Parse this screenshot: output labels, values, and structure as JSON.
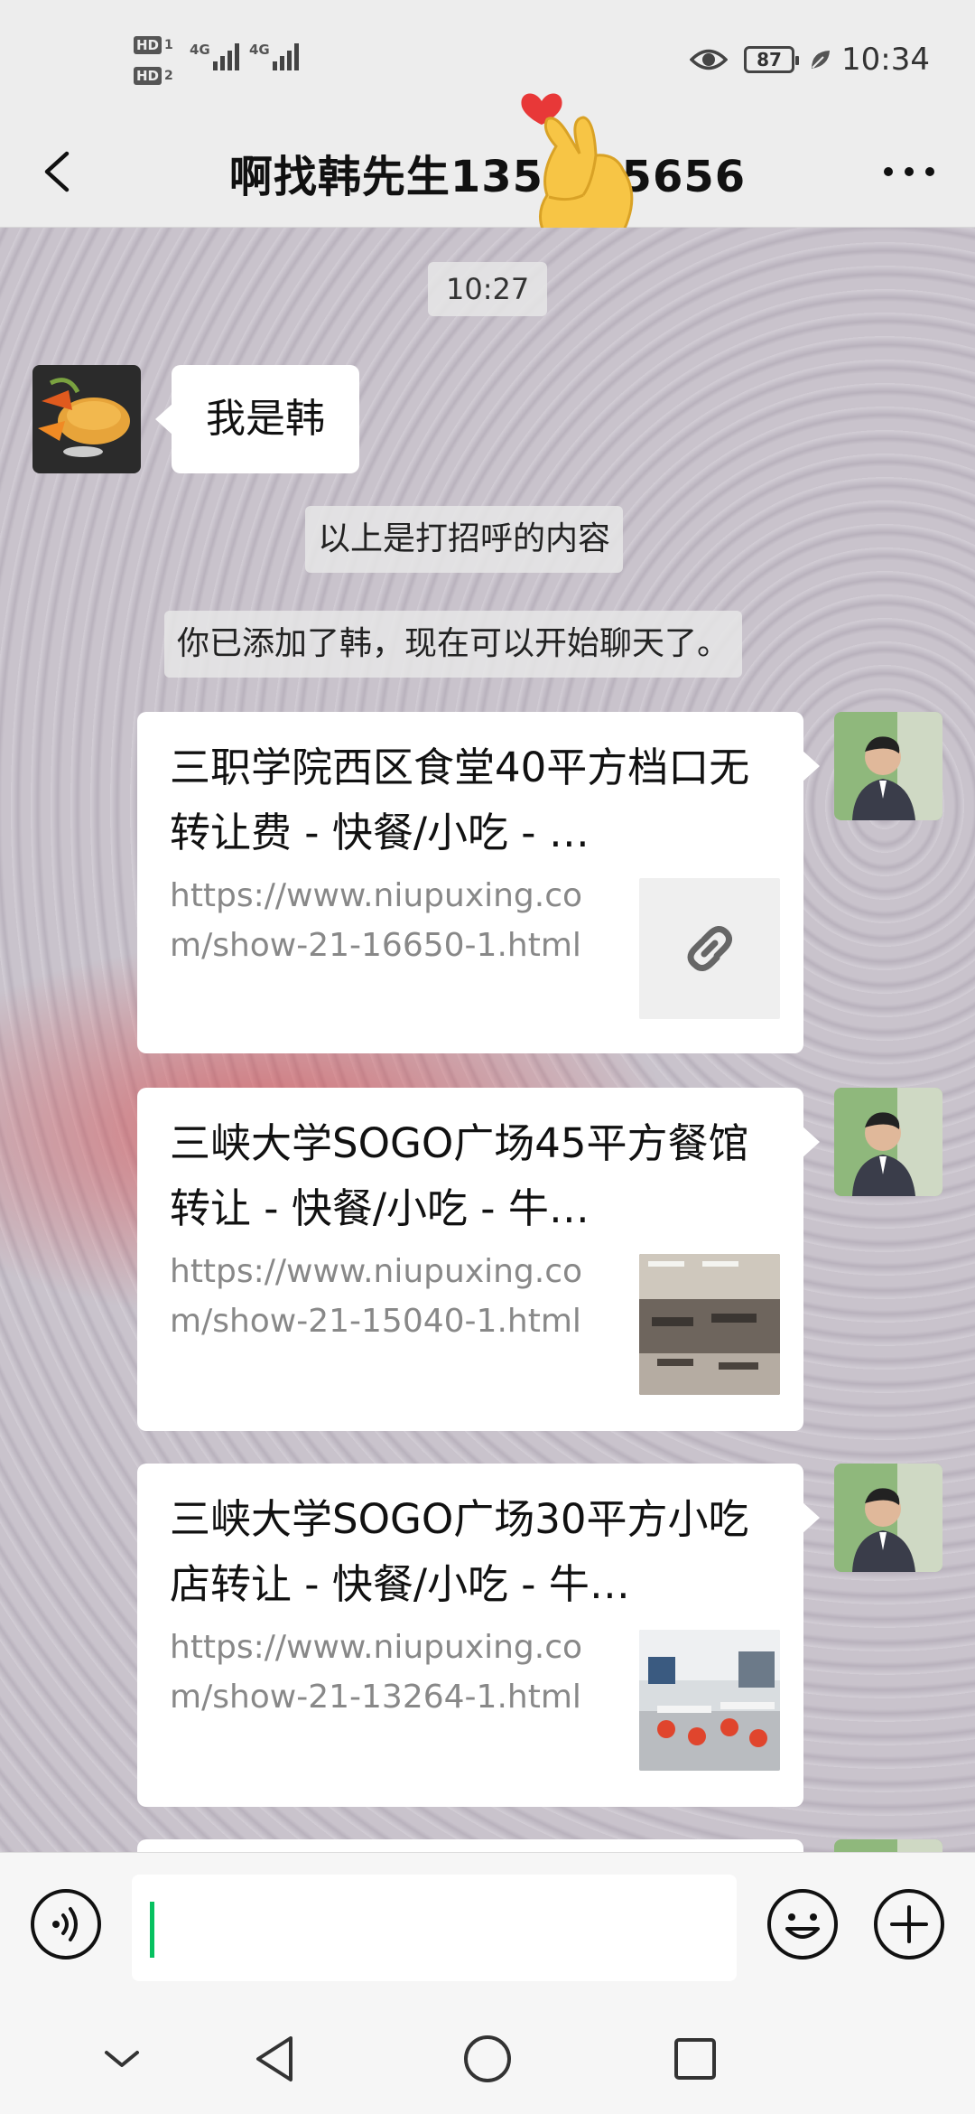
{
  "status_bar": {
    "sim1": {
      "hd": "HD",
      "index": "1",
      "net": "4G"
    },
    "sim2": {
      "hd": "HD",
      "index": "2",
      "net": "4G"
    },
    "battery": "87",
    "time": "10:34",
    "icons": [
      "eye-comfort-icon",
      "battery-icon",
      "leaf-icon"
    ]
  },
  "header": {
    "title": "啊找韩先生135  835656",
    "back_icon": "chevron-left-icon",
    "more_icon": "more-dots-icon",
    "overlay_sticker": "finger-heart-sticker"
  },
  "chat": {
    "timestamp": "10:27",
    "greeting_message": "我是韩",
    "system_messages": [
      "以上是打招呼的内容",
      "你已添加了韩，现在可以开始聊天了。"
    ],
    "link_cards": [
      {
        "title": "三职学院西区食堂40平方档口无转让费 - 快餐/小吃 - …",
        "url": "https://www.niupuxing.com/show-21-16650-1.html",
        "thumb": "link-icon"
      },
      {
        "title": "三峡大学SOGO广场45平方餐馆转让 - 快餐/小吃 - 牛…",
        "url": "https://www.niupuxing.com/show-21-15040-1.html",
        "thumb": "restaurant-photo"
      },
      {
        "title": "三峡大学SOGO广场30平方小吃店转让 - 快餐/小吃 - 牛…",
        "url": "https://www.niupuxing.com/show-21-13264-1.html",
        "thumb": "snack-shop-photo"
      }
    ]
  },
  "input_bar": {
    "voice_icon": "voice-icon",
    "text_value": "",
    "emoji_icon": "emoji-icon",
    "plus_icon": "plus-icon"
  },
  "nav_bar": {
    "icons": [
      "nav-collapse-icon",
      "nav-back-icon",
      "nav-home-icon",
      "nav-recent-icon"
    ]
  },
  "colors": {
    "accent_green": "#07c160",
    "bubble_white": "#ffffff",
    "page_bg": "#ededed"
  }
}
